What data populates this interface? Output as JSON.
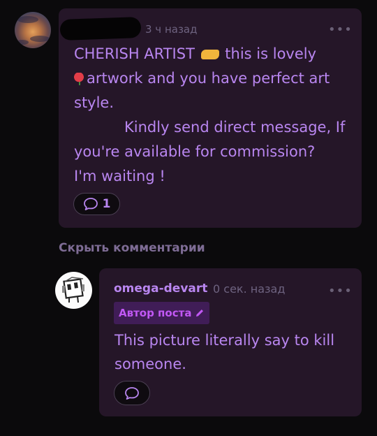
{
  "comment": {
    "time": "3 ч назад",
    "text_line1_prefix": "CHERISH ARTIST",
    "text_line1_suffix": "this is lovely",
    "text_line2": "artwork and you have perfect art",
    "text_line3": "style.",
    "text_line4": "Kindly send direct message, If",
    "text_line5": "you're available for commission?",
    "text_line6": "I'm waiting !",
    "reply_count": "1"
  },
  "hide_comments_label": "Скрыть комментарии",
  "reply": {
    "author": "omega-devart",
    "time": "0 сек. назад",
    "badge": "Автор поста",
    "text": "This picture literally say to kill someone."
  },
  "colors": {
    "background": "#0b0a0c",
    "card": "#251628",
    "text_accent": "#b986f0",
    "badge_bg": "#401d57",
    "badge_text": "#c158f5",
    "muted": "#6e6380"
  },
  "icons": {
    "handshake": "handshake-emoji",
    "rose": "rose-emoji",
    "reply": "speech-bubble-icon",
    "more": "ellipsis-icon",
    "edit": "pencil-icon"
  }
}
